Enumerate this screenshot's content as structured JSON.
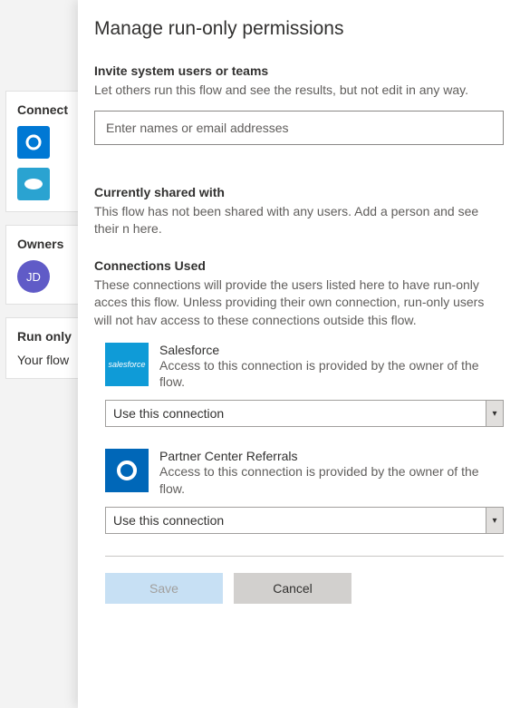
{
  "background": {
    "connect_label": "Connect",
    "owners_label": "Owners",
    "owner_initials": "JD",
    "runonly_label": "Run only",
    "runonly_body": "Your flow"
  },
  "panel": {
    "title": "Manage run-only permissions",
    "invite": {
      "title": "Invite system users or teams",
      "desc": "Let others run this flow and see the results, but not edit in any way.",
      "placeholder": "Enter names or email addresses"
    },
    "shared": {
      "title": "Currently shared with",
      "desc": "This flow has not been shared with any users. Add a person and see their n here."
    },
    "connections": {
      "title": "Connections Used",
      "desc": "These connections will provide the users listed here to have run-only acces this flow. Unless providing their own connection, run-only users will not hav access to these connections outside this flow.",
      "items": [
        {
          "name": "Salesforce",
          "sub": "Access to this connection is provided by the owner of the flow.",
          "select": "Use this connection"
        },
        {
          "name": "Partner Center Referrals",
          "sub": "Access to this connection is provided by the owner of the flow.",
          "select": "Use this connection"
        }
      ]
    },
    "buttons": {
      "save": "Save",
      "cancel": "Cancel"
    }
  }
}
